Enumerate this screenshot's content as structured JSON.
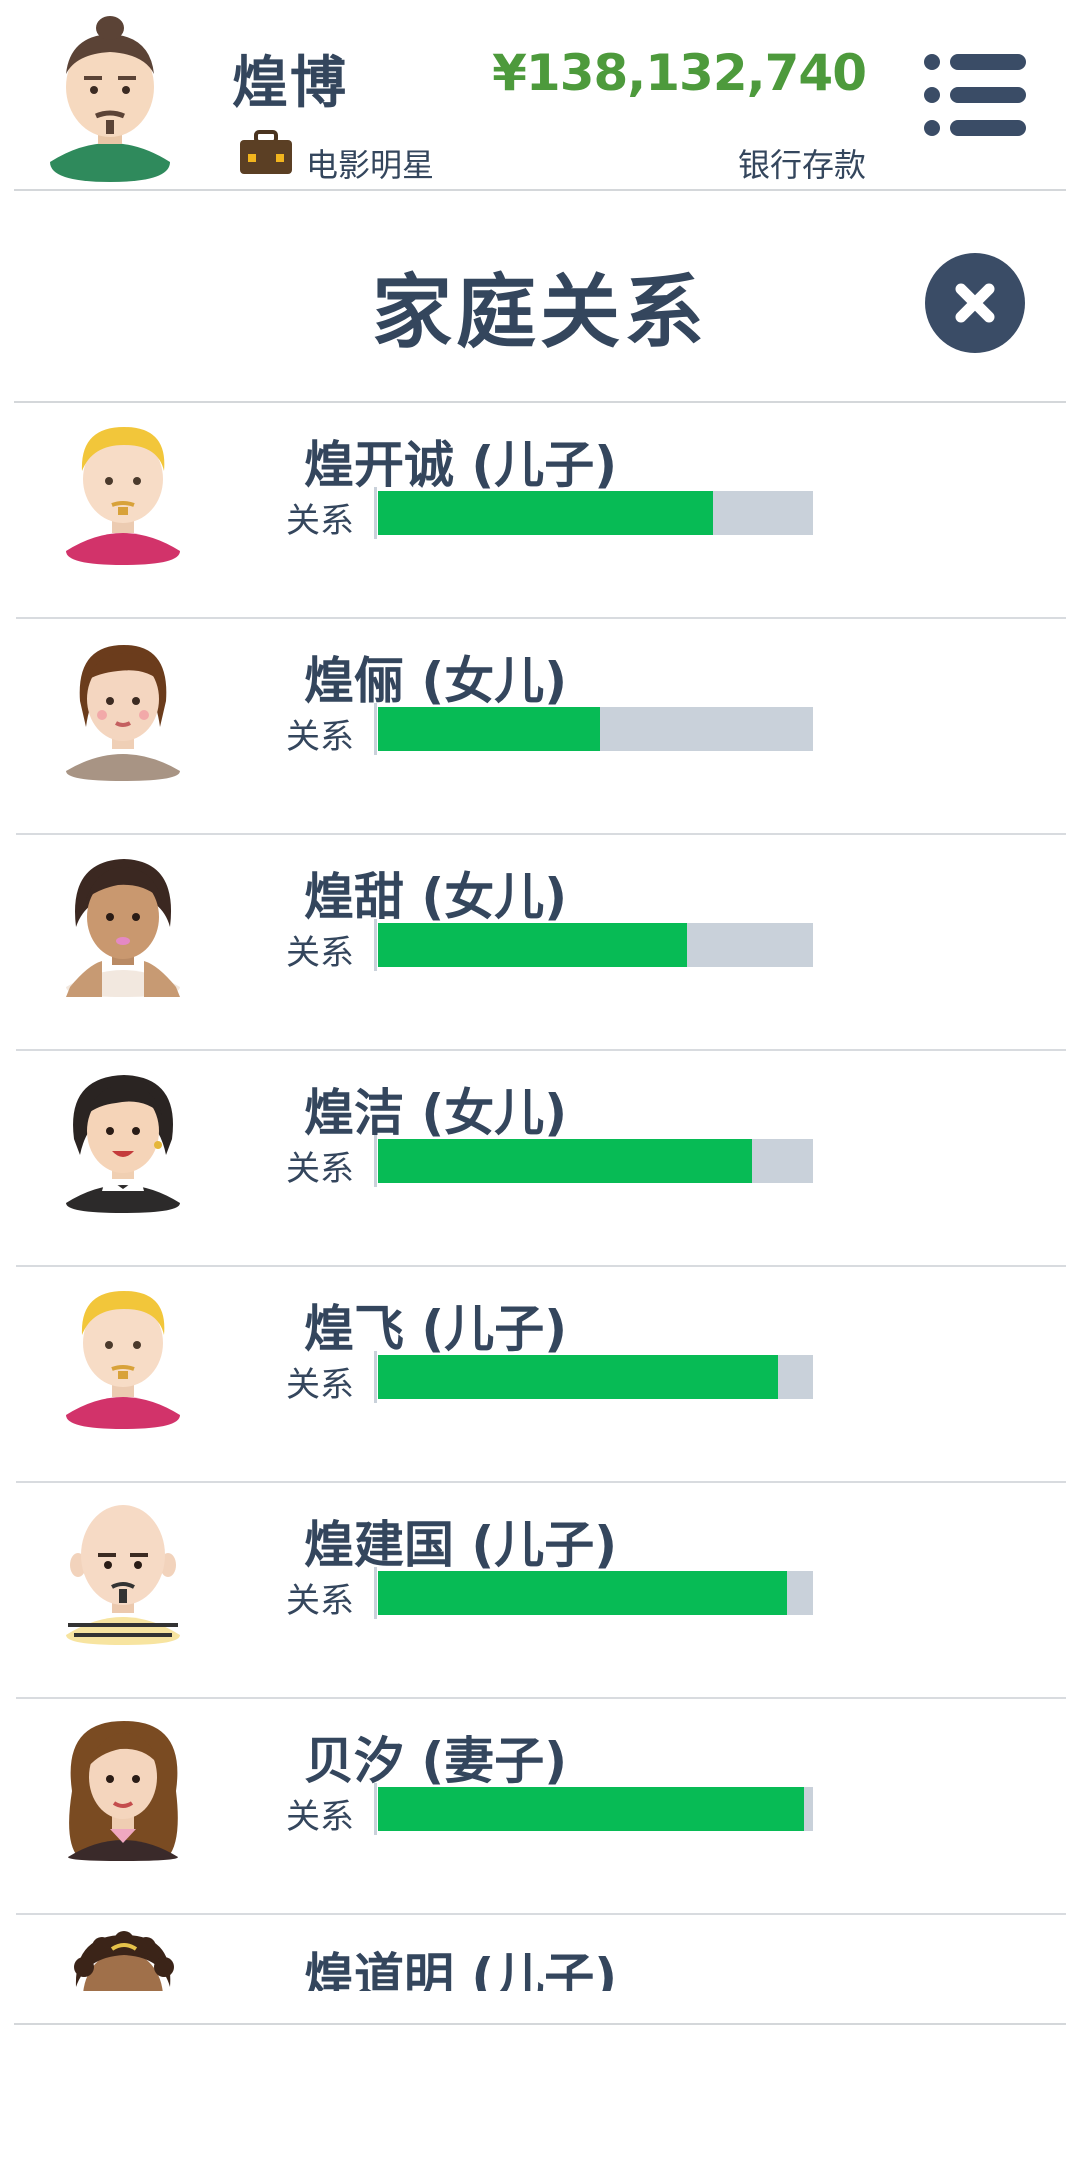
{
  "header": {
    "player_name": "煌博",
    "job": "电影明星",
    "money": "¥138,132,740",
    "money_label": "银行存款",
    "menu_icon": "list-menu-icon",
    "job_icon": "briefcase-icon"
  },
  "page": {
    "title": "家庭关系",
    "close_icon": "close-icon"
  },
  "colors": {
    "text": "#34465d",
    "money": "#4d9a3c",
    "bar_fill": "#07bb55",
    "bar_track": "#c9d1da",
    "close_bg": "#3a4c66"
  },
  "relation_label": "关系",
  "family": [
    {
      "name": "煌开诚 (儿子)",
      "relationship": 0.77,
      "avatar": "blond-man-avatar"
    },
    {
      "name": "煌俪 (女儿)",
      "relationship": 0.51,
      "avatar": "brown-hair-woman-avatar"
    },
    {
      "name": "煌甜 (女儿)",
      "relationship": 0.71,
      "avatar": "dark-skin-woman-avatar"
    },
    {
      "name": "煌洁 (女儿)",
      "relationship": 0.86,
      "avatar": "black-hair-woman-avatar"
    },
    {
      "name": "煌飞 (儿子)",
      "relationship": 0.92,
      "avatar": "blond-man-avatar"
    },
    {
      "name": "煌建国 (儿子)",
      "relationship": 0.94,
      "avatar": "bald-man-avatar"
    },
    {
      "name": "贝汐 (妻子)",
      "relationship": 0.98,
      "avatar": "long-hair-woman-avatar"
    },
    {
      "name": "煌道明 (儿子)",
      "relationship": null,
      "avatar": "curly-hair-man-avatar"
    }
  ]
}
